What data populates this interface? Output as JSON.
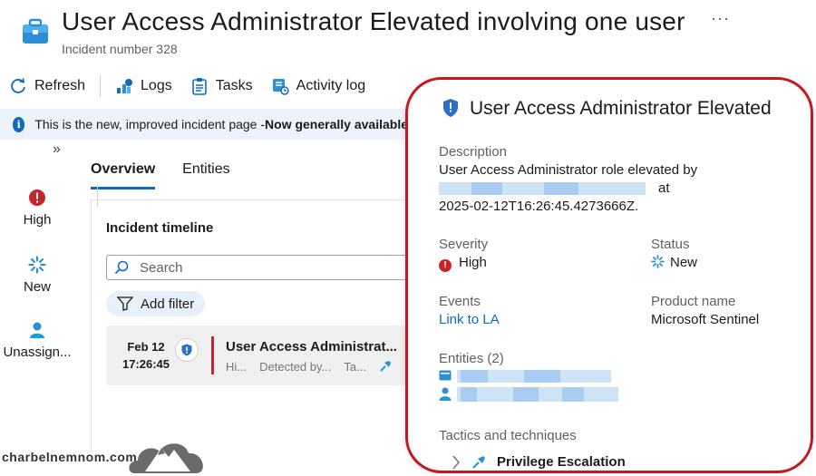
{
  "header": {
    "title": "User Access Administrator Elevated involving one user",
    "subtitle": "Incident number 328",
    "more": "···"
  },
  "toolbar": {
    "refresh": "Refresh",
    "logs": "Logs",
    "tasks": "Tasks",
    "activity_log": "Activity log"
  },
  "banner": {
    "text": "This is the new, improved incident page - ",
    "bold": "Now generally available"
  },
  "rail": {
    "severity": "High",
    "status": "New",
    "owner": "Unassign..."
  },
  "tabs": [
    "Overview",
    "Entities"
  ],
  "timeline": {
    "title": "Incident timeline",
    "search_placeholder": "Search",
    "filter_label": "Add filter",
    "row": {
      "date": "Feb 12",
      "time": "17:26:45",
      "name": "User Access Administrat...",
      "meta1": "Hi...",
      "meta2": "Detected by...",
      "meta3": "Ta..."
    }
  },
  "panel": {
    "title": "User Access Administrator Elevated",
    "description_label": "Description",
    "description_line1": "User Access Administrator role elevated by",
    "description_at": "at",
    "description_line3": "2025-02-12T16:26:45.4273666Z.",
    "severity_label": "Severity",
    "severity_value": "High",
    "status_label": "Status",
    "status_value": "New",
    "events_label": "Events",
    "events_link": "Link to LA",
    "product_label": "Product name",
    "product_value": "Microsoft Sentinel",
    "entities_label": "Entities (2)",
    "tactics_label": "Tactics and techniques",
    "tactic_value": "Privilege Escalation"
  },
  "watermark": "charbelnemnom.com",
  "colors": {
    "accent": "#0f6cbd",
    "severity_high": "#c4262e",
    "highlight_border": "#c8161d",
    "banner_bg": "#eef3fb"
  }
}
